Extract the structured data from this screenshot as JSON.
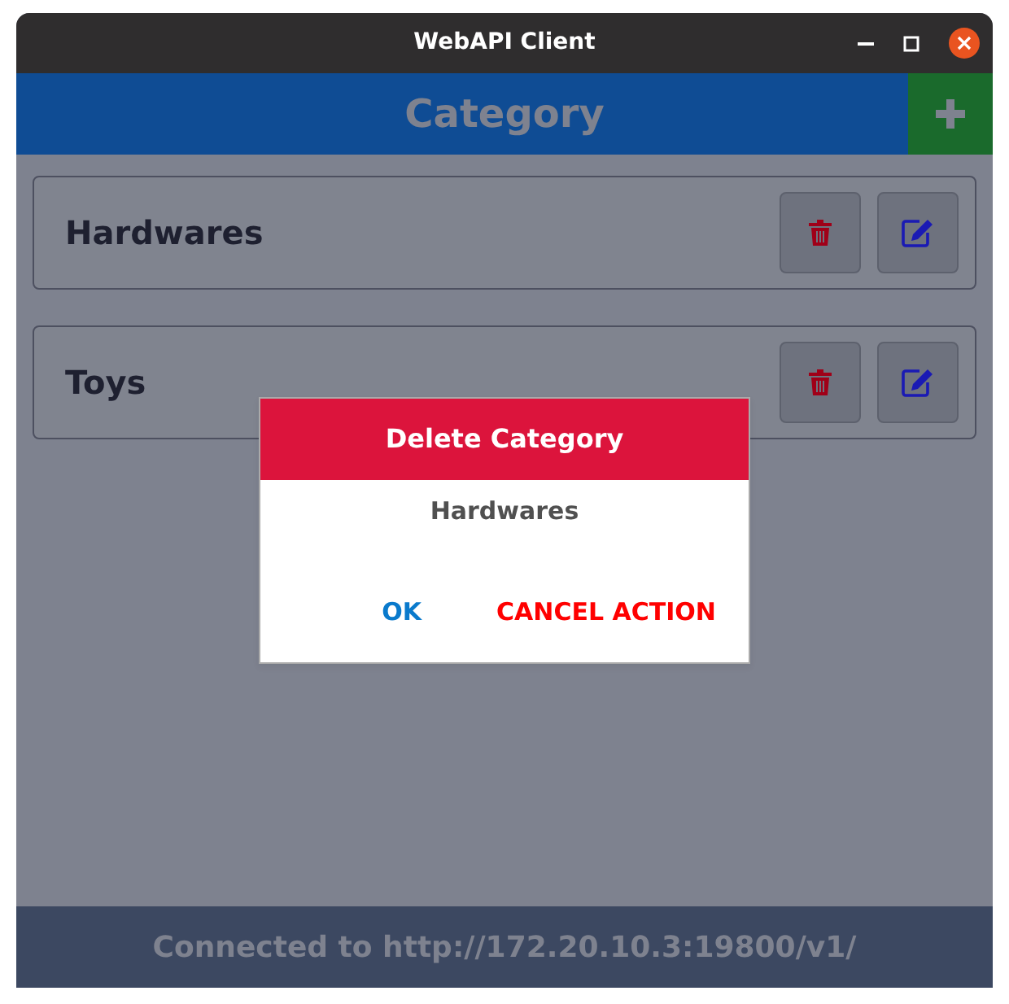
{
  "window": {
    "title": "WebAPI Client"
  },
  "header": {
    "title": "Category"
  },
  "categories": [
    {
      "name": "Hardwares"
    },
    {
      "name": "Toys"
    }
  ],
  "dialog": {
    "title": "Delete Category",
    "message": "Hardwares",
    "buttons": [
      {
        "label": "OK",
        "kind": "confirm"
      },
      {
        "label": "CANCEL ACTION",
        "kind": "cancel"
      }
    ]
  },
  "status_bar": "Connected to http://172.20.10.3:19800/v1/"
}
